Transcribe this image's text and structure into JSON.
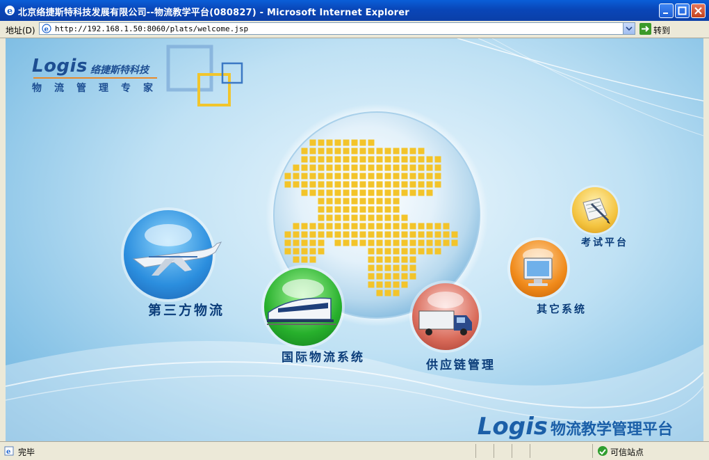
{
  "window": {
    "title": "北京络捷斯特科技发展有限公司--物流教学平台(080827) - Microsoft Internet Explorer"
  },
  "address_bar": {
    "label": "地址(D)",
    "url": "http://192.168.1.50:8060/plats/welcome.jsp",
    "go_label": "转到"
  },
  "header": {
    "logo_text": "Logis",
    "company": "络捷斯特科技",
    "slogan": "物流管理专家"
  },
  "modules": [
    {
      "label": "第三方物流",
      "icon": "airplane-icon"
    },
    {
      "label": "国际物流系统",
      "icon": "train-icon"
    },
    {
      "label": "供应链管理",
      "icon": "truck-icon"
    },
    {
      "label": "其它系统",
      "icon": "monitor-icon"
    },
    {
      "label": "考试平台",
      "icon": "exam-paper-icon"
    }
  ],
  "footer": {
    "logo_text": "Logis",
    "tagline": "物流教学管理平台"
  },
  "status_bar": {
    "status": "完毕",
    "zone": "可信站点"
  },
  "colors": {
    "title_bar": "#0a4fc8",
    "brand_blue": "#1d4e92",
    "label_blue": "#0b3d7a",
    "globe_dots": "#f3c42a"
  }
}
